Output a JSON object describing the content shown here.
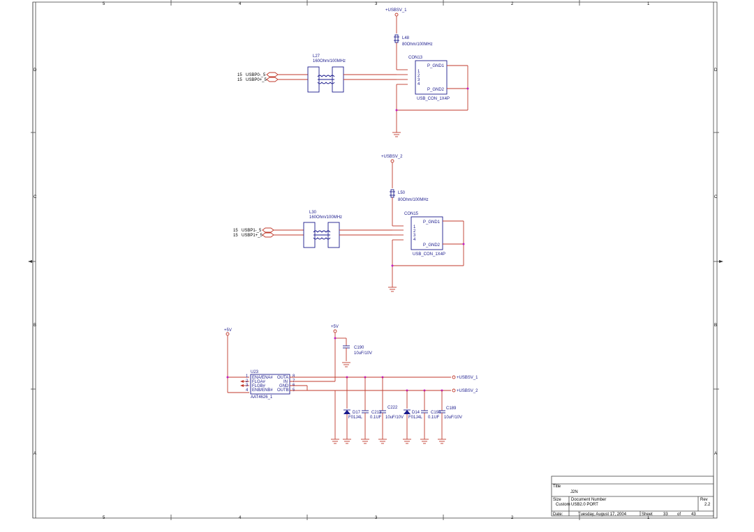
{
  "frame": {
    "col_top": [
      "5",
      "4",
      "3",
      "2",
      "1"
    ],
    "col_bottom": [
      "5",
      "4",
      "3",
      "2",
      "1"
    ],
    "row_left": [
      "D",
      "C",
      "B",
      "A"
    ],
    "row_right": [
      "D",
      "C",
      "B",
      "A"
    ]
  },
  "port1": {
    "rail": "+USBSV_1",
    "choke_ref": "L48",
    "choke_val": "80Ohm/100MHz",
    "cmc_ref": "L27",
    "cmc_val": "160Ohm/100MHz",
    "conn_ref": "CON13",
    "conn_val": "USB_CON_1X4P",
    "gnd1": "P_GND1",
    "gnd2": "P_GND2",
    "net_minus": "USBP0-_5",
    "net_plus": "USBP0+_5",
    "page_ref": "15"
  },
  "port2": {
    "rail": "+USBSV_2",
    "choke_ref": "L50",
    "choke_val": "80Ohm/100MHz",
    "cmc_ref": "L30",
    "cmc_val": "160Ohm/100MHz",
    "conn_ref": "CON15",
    "conn_val": "USB_CON_1X4P",
    "gnd1": "P_GND1",
    "gnd2": "P_GND2",
    "net_minus": "USBP1-_5",
    "net_plus": "USBP1+_5",
    "page_ref": "15"
  },
  "power": {
    "rail_left": "+5V",
    "rail_cap": "+5V",
    "c190_ref": "C190",
    "c190_val": "10uF/10V",
    "ic_ref": "U23",
    "ic_val": "AAT4626_1",
    "pins_left": [
      "ENA/ENA#",
      "FLGA#",
      "FLGB#",
      "ENB/ENB#"
    ],
    "pins_right": [
      "OUTA",
      "IN",
      "GND",
      "OUTB"
    ],
    "out1": "+USBSV_1",
    "out2": "+USBSV_2",
    "d17_ref": "D17",
    "d17_val": "F01J4L",
    "c213_ref": "C213",
    "c213_val": "0.1UF",
    "c222_ref": "C222",
    "c222_val": "10uF/10V",
    "d14_ref": "D14",
    "d14_val": "F01J4L",
    "c194_ref": "C194",
    "c194_val": "0.1UF",
    "c189_ref": "C189",
    "c189_val": "10uF/10V"
  },
  "title_block": {
    "title_label": "Title",
    "title": "J2N",
    "size_label": "Size",
    "size": "Custom",
    "docnum_label": "Document Number",
    "docnum": "USB2.0 PORT",
    "rev_label": "Rev",
    "rev": "2.2",
    "date_label": "Date:",
    "date": "Tuesday, August 17, 2004",
    "sheet_label": "Sheet",
    "sheet": "33",
    "of_label": "of",
    "total": "43"
  }
}
